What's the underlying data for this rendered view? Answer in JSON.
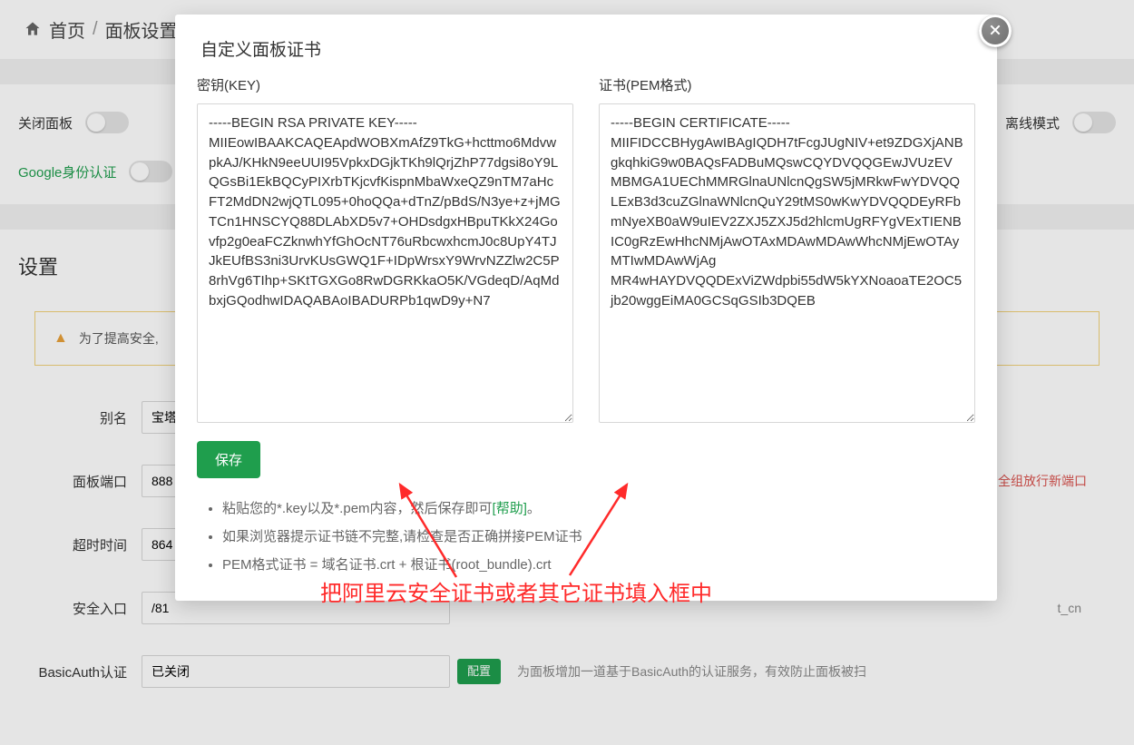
{
  "breadcrumb": {
    "home": "首页",
    "current": "面板设置"
  },
  "band": {
    "close_panel": "关闭面板",
    "offline_mode": "离线模式",
    "google_auth": "Google身份认证"
  },
  "settings_heading": "设置",
  "notice": {
    "text": "为了提高安全,"
  },
  "form": {
    "alias_label": "别名",
    "alias_value": "宝塔",
    "port_label": "面板端口",
    "port_value": "888",
    "port_tail": "全组放行新端口",
    "timeout_label": "超时时间",
    "timeout_value": "864",
    "entrance_label": "安全入口",
    "entrance_value": "/81",
    "entrance_tail_right": "t_cn",
    "basicauth_label": "BasicAuth认证",
    "basicauth_value": "已关闭",
    "basicauth_btn": "配置",
    "basicauth_tail": "为面板增加一道基于BasicAuth的认证服务，有效防止面板被扫"
  },
  "modal": {
    "title": "自定义面板证书",
    "key_label": "密钥(KEY)",
    "pem_label": "证书(PEM格式)",
    "key_text": "-----BEGIN RSA PRIVATE KEY-----\nMIIEowIBAAKCAQEApdWOBXmAfZ9TkG+hcttmo6MdvwpkAJ/KHkN9eeUUI95VpkxDGjkTKh9lQrjZhP77dgsi8oY9LQGsBi1EkBQCyPIXrbTKjcvfKispnMbaWxeQZ9nTM7aHcFT2MdDN2wjQTL095+0hoQQa+dTnZ/pBdS/N3ye+z+jMGTCn1HNSCYQ88DLAbXD5v7+OHDsdgxHBpuTKkX24Govfp2g0eaFCZknwhYfGhOcNT76uRbcwxhcmJ0c8UpY4TJJkEUfBS3ni3UrvKUsGWQ1F+IDpWrsxY9WrvNZZlw2C5P8rhVg6TIhp+SKtTGXGo8RwDGRKkaO5K/VGdeqD/AqMdbxjGQodhwIDAQABAoIBADURPb1qwD9y+N7",
    "pem_text": "-----BEGIN CERTIFICATE-----\nMIIFIDCCBHygAwIBAgIQDH7tFcgJUgNIV+et9ZDGXjANBgkqhkiG9w0BAQsFADBuMQswCQYDVQQGEwJVUzEVMBMGA1UEChMMRGlnaUNlcnQgSW5jMRkwFwYDVQQLExB3d3cuZGlnaWNlcnQuY29tMS0wKwYDVQQDEyRFbmNyeXB0aW9uIEV2ZXJ5ZXJ5d2hlcmUgRFYgVExTIENBIC0gRzEwHhcNMjAwOTAxMDAwMDAwWhcNMjEwOTAyMTIwMDAwWjAg\nMR4wHAYDVQQDExViZWdpbi55dW5kYXNoaoaTE2OC5jb20wggEiMA0GCSqGSIb3DQEB",
    "save": "保存",
    "tips": {
      "t1a": "粘贴您的*.key以及*.pem内容，然后保存即可",
      "t1_help": "[帮助]",
      "t1b": "。",
      "t2": "如果浏览器提示证书链不完整,请检查是否正确拼接PEM证书",
      "t3": "PEM格式证书 = 域名证书.crt + 根证书(root_bundle).crt"
    }
  },
  "annotation": {
    "text": "把阿里云安全证书或者其它证书填入框中"
  }
}
